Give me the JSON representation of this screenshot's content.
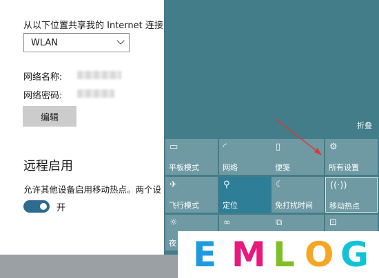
{
  "settings": {
    "share_label": "从以下位置共享我的 Internet 连接",
    "share_select_value": "WLAN",
    "network_name_label": "网络名称:",
    "network_password_label": "网络密码:",
    "edit_button": "编辑",
    "remote_section_title": "远程启用",
    "remote_allow_text": "允许其他设备启用移动热点。两个设",
    "toggle_state_label": "开",
    "toggle_on": true
  },
  "action_center": {
    "collapse_label": "折叠",
    "tiles": [
      {
        "label": "平板模式",
        "icon": "tablet-mode-icon"
      },
      {
        "label": "网络",
        "icon": "network-icon"
      },
      {
        "label": "便笺",
        "icon": "note-icon"
      },
      {
        "label": "所有设置",
        "icon": "gear-icon"
      },
      {
        "label": "飞行模式",
        "icon": "airplane-icon"
      },
      {
        "label": "定位",
        "icon": "location-icon",
        "active": true
      },
      {
        "label": "免打扰时间",
        "icon": "moon-icon"
      },
      {
        "label": "移动热点",
        "icon": "hotspot-icon",
        "selected": true
      },
      {
        "label": "夜",
        "icon": "brightness-icon"
      },
      {
        "label": "",
        "icon": "connect-icon"
      },
      {
        "label": "",
        "icon": "project-icon"
      },
      {
        "label": "",
        "icon": "vpn-icon"
      }
    ]
  },
  "watermark": {
    "letters": [
      "E",
      "M",
      "L",
      "O",
      "G"
    ],
    "colors": [
      "#1e9be0",
      "#e5197e",
      "#7fbf24",
      "#f5a623",
      "#12c2d6"
    ]
  }
}
